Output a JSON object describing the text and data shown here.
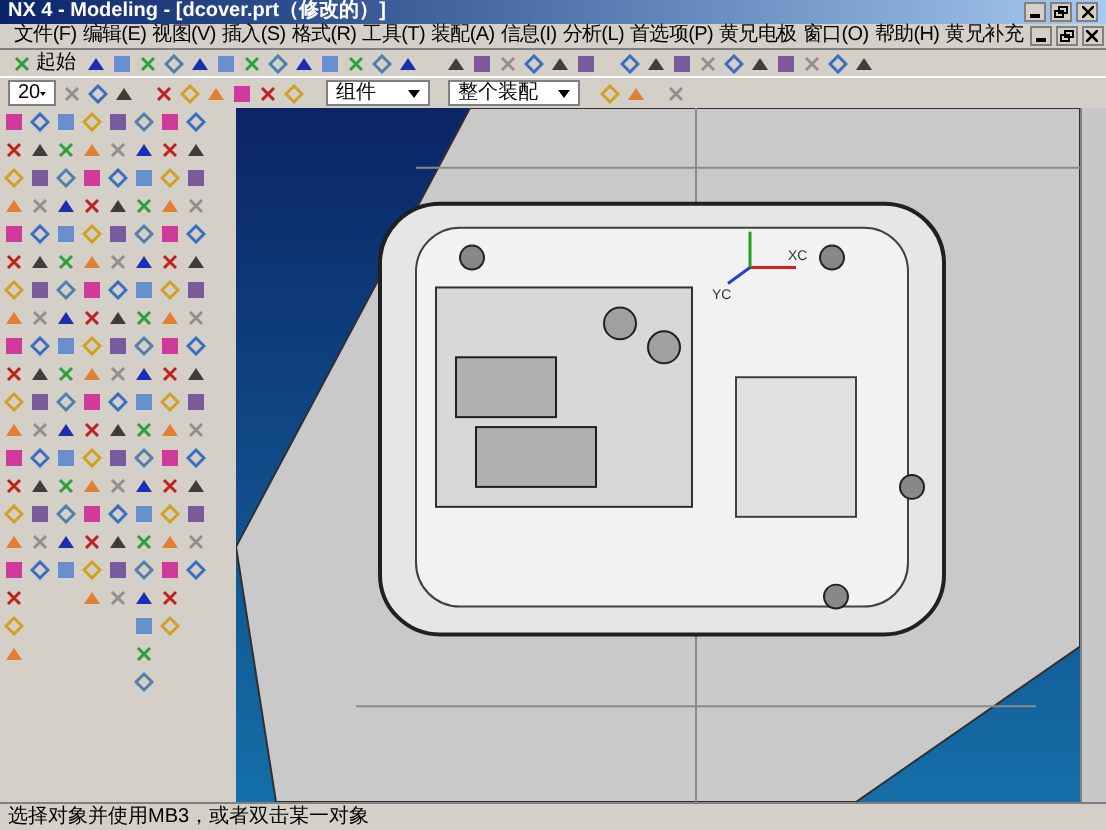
{
  "window": {
    "title": "NX 4 - Modeling - [dcover.prt（修改的）]"
  },
  "menu": [
    "文件(F)",
    "编辑(E)",
    "视图(V)",
    "插入(S)",
    "格式(R)",
    "工具(T)",
    "装配(A)",
    "信息(I)",
    "分析(L)",
    "首选项(P)",
    "黄兄电极",
    "窗口(O)",
    "帮助(H)",
    "黄兄补充"
  ],
  "toolbar": {
    "start_button": "起始",
    "scale_combo": "20",
    "filter_combo": "组件",
    "scope_combo": "整个装配"
  },
  "viewport": {
    "triad_labels": [
      "XC",
      "YC"
    ]
  },
  "status_bar": {
    "message": "选择对象并使用MB3，或者双击某一对象"
  }
}
